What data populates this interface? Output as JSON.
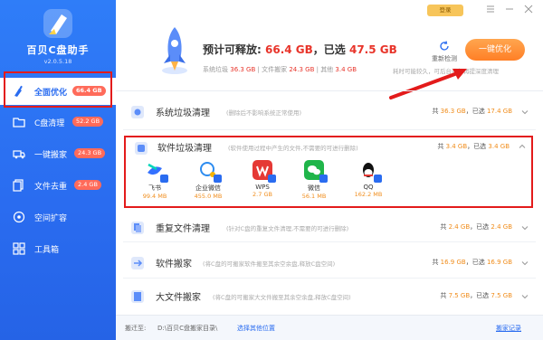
{
  "app": {
    "name": "百贝C盘助手",
    "version": "v2.0.5.18"
  },
  "window": {
    "login_label": "登录",
    "menu_icon": "menu-icon",
    "minimize_icon": "minimize-icon",
    "close_icon": "close-icon"
  },
  "sidebar": {
    "items": [
      {
        "label": "全面优化",
        "badge": "66.4 GB",
        "icon": "broom-icon"
      },
      {
        "label": "C盘清理",
        "badge": "52.2 GB",
        "icon": "folder-icon"
      },
      {
        "label": "一键搬家",
        "badge": "24.3 GB",
        "icon": "truck-icon"
      },
      {
        "label": "文件去重",
        "badge": "2.4 GB",
        "icon": "files-icon"
      },
      {
        "label": "空间扩容",
        "badge": "",
        "icon": "disk-icon"
      },
      {
        "label": "工具箱",
        "badge": "",
        "icon": "grid-icon"
      }
    ]
  },
  "summary": {
    "prefix": "预计可释放:",
    "total": "66.4 GB",
    "sep": "，已选",
    "selected": "47.5 GB",
    "breakdown": {
      "sys_label": "系统垃圾",
      "sys_value": "36.3 GB",
      "move_label": "文件搬家",
      "move_value": "24.3 GB",
      "other_label": "其他",
      "other_value": "3.4 GB"
    },
    "rescan_label": "重新检测",
    "optimize_label": "一键优化",
    "hint": "耗时可能较久，可后台进行再提深度清理"
  },
  "rows": [
    {
      "title": "系统垃圾清理",
      "desc": "(删除后不影响系统正常使用)",
      "total_prefix": "共",
      "total": "36.3 GB",
      "sel_prefix": "，已选",
      "selected": "17.4 GB"
    },
    {
      "title": "软件垃圾清理",
      "desc": "(软件使用过程中产生的文件,不需要的可进行删除)",
      "total_prefix": "共",
      "total": "3.4 GB",
      "sel_prefix": "，已选",
      "selected": "3.4 GB"
    },
    {
      "title": "重复文件清理",
      "desc": "(针对C盘的重复文件清理,不需要的可进行删除)",
      "total_prefix": "共",
      "total": "2.4 GB",
      "sel_prefix": "，已选",
      "selected": "2.4 GB"
    },
    {
      "title": "软件搬家",
      "desc": "(将C盘的可搬家软件搬至其余空余盘,释放C盘空间)",
      "total_prefix": "共",
      "total": "16.9 GB",
      "sel_prefix": "，已选",
      "selected": "16.9 GB"
    },
    {
      "title": "大文件搬家",
      "desc": "(将C盘的可搬家大文件搬至其余空余盘,释放C盘空间)",
      "total_prefix": "共",
      "total": "7.5 GB",
      "sel_prefix": "，已选",
      "selected": "7.5 GB"
    }
  ],
  "apps": [
    {
      "name": "飞书",
      "size": "99.4 MB",
      "color": "#3370ff"
    },
    {
      "name": "企业微信",
      "size": "455.0 MB",
      "color": "#2d8cf0"
    },
    {
      "name": "WPS",
      "size": "2.7 GB",
      "color": "#e53935"
    },
    {
      "name": "微信",
      "size": "56.1 MB",
      "color": "#20b54a"
    },
    {
      "name": "QQ",
      "size": "162.2 MB",
      "color": "#111111"
    }
  ],
  "footer": {
    "move_to_label": "搬迁至:",
    "path": "D:\\百贝C盘搬家目录\\",
    "choose_label": "选择其他位置",
    "log_label": "搬家记录"
  },
  "colors": {
    "accent": "#2a6cf0",
    "orange": "#ff8a2a",
    "red": "#e8342a",
    "highlight_box": "#e31b1b"
  }
}
